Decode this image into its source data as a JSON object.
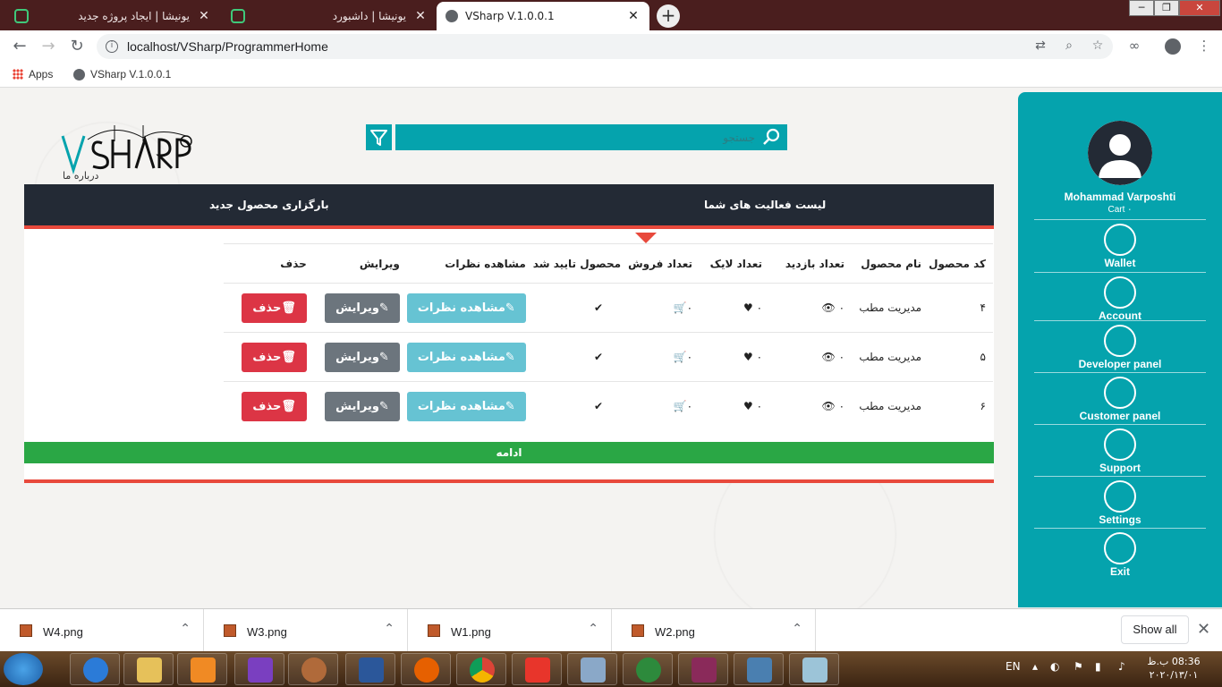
{
  "browser": {
    "tabs": [
      {
        "title": "یونیشا | ایجاد پروژه جدید",
        "close": "✕"
      },
      {
        "title": "یونیشا | داشبورد",
        "close": "✕"
      },
      {
        "title": "VSharp V.1.0.0.1",
        "close": "✕"
      }
    ],
    "new_tab": "+",
    "url": "localhost/VSharp/ProgrammerHome",
    "bookmarks": [
      {
        "label": "Apps"
      },
      {
        "label": "VSharp V.1.0.0.1"
      }
    ]
  },
  "site": {
    "logo_text": "VSHARP",
    "about_link": "درباره ما",
    "search_placeholder": "جستجو"
  },
  "activity": {
    "title": "لیست فعالیت های شما",
    "upload_link": "بارگزاری محصول جدید"
  },
  "table": {
    "headers": [
      "کد محصول",
      "نام محصول",
      "تعداد بازدید",
      "تعداد لایک",
      "تعداد فروش",
      "محصول تایید شد",
      "مشاهده نظرات",
      "ویرایش",
      "حذف"
    ],
    "rows": [
      {
        "code": "۴",
        "name": "مدیریت مطب",
        "views": "۰",
        "likes": "۰",
        "sales": "۰",
        "approved": "✔",
        "comments_btn": "مشاهده نظرات",
        "edit_btn": "ویرایش",
        "delete_btn": "حذف"
      },
      {
        "code": "۵",
        "name": "مدیریت مطب",
        "views": "۰",
        "likes": "۰",
        "sales": "۰",
        "approved": "✔",
        "comments_btn": "مشاهده نظرات",
        "edit_btn": "ویرایش",
        "delete_btn": "حذف"
      },
      {
        "code": "۶",
        "name": "مدیریت مطب",
        "views": "۰",
        "likes": "۰",
        "sales": "۰",
        "approved": "✔",
        "comments_btn": "مشاهده نظرات",
        "edit_btn": "ویرایش",
        "delete_btn": "حذف"
      }
    ],
    "continue": "ادامه"
  },
  "sidebar": {
    "user_name": "Mohammad Varposhti",
    "cart": "Cart ۰",
    "items": [
      {
        "label": "Wallet",
        "icon": "wallet-icon"
      },
      {
        "label": "Account",
        "icon": "account-icon"
      },
      {
        "label": "Developer panel",
        "icon": "developer-icon"
      },
      {
        "label": "Customer panel",
        "icon": "customer-icon"
      },
      {
        "label": "Support",
        "icon": "lifebuoy-icon"
      },
      {
        "label": "Settings",
        "icon": "gear-icon"
      },
      {
        "label": "Exit",
        "icon": "exit-icon"
      }
    ]
  },
  "downloads": {
    "files": [
      "W4.png",
      "W3.png",
      "W1.png",
      "W2.png"
    ],
    "show_all": "Show all"
  },
  "taskbar": {
    "lang": "EN",
    "time": "08:36 ب.ظ",
    "date": "۲۰۲۰/۱۳/۰۱"
  },
  "colors": {
    "teal": "#05a3ad",
    "dark_bar": "#232a35",
    "red_accent": "#e8493c",
    "green": "#2aa745"
  }
}
